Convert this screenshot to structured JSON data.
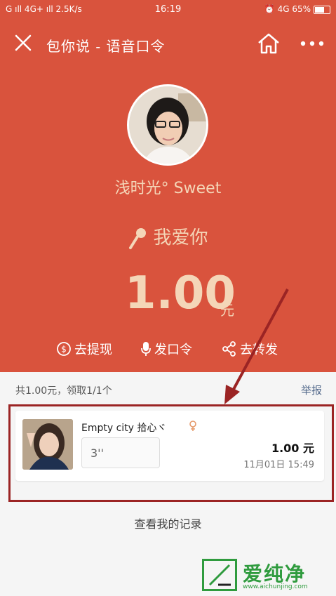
{
  "status_bar": {
    "left": "G ıll 4G+ ıll 2.5K/s",
    "time": "16:19",
    "right": "⏰ 4G 65%"
  },
  "navbar": {
    "title": "包你说 - 语音口令"
  },
  "sender": {
    "name": "浅时光° Sweet"
  },
  "phrase": "我爱你",
  "amount": {
    "value": "1.00",
    "unit": "元"
  },
  "actions": [
    {
      "label": "去提现",
      "icon": "dollar-icon"
    },
    {
      "label": "发口令",
      "icon": "microphone-icon"
    },
    {
      "label": "去转发",
      "icon": "share-icon"
    }
  ],
  "summary": {
    "text": "共1.00元，领取1/1个",
    "report": "举报"
  },
  "record": {
    "username": "Empty city 拾心ヾ",
    "voice_duration": "3''",
    "amount": "1.00 元",
    "time": "11月01日 15:49"
  },
  "view_records": "查看我的记录",
  "watermark": {
    "name": "爱纯净",
    "url": "www.aichunjing.com"
  },
  "colors": {
    "header_bg": "#d9533d",
    "accent_text": "#f4d6b8",
    "highlight_border": "#9b2424",
    "watermark_green": "#2f9b3e"
  }
}
